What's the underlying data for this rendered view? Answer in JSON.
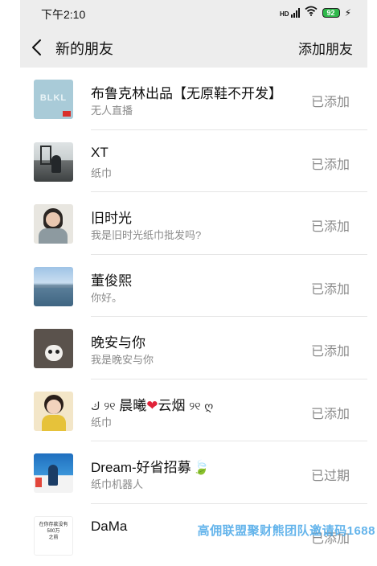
{
  "status_bar": {
    "time": "下午2:10",
    "network": "HD",
    "battery": "92"
  },
  "nav": {
    "title": "新的朋友",
    "action": "添加朋友"
  },
  "friends": [
    {
      "name": "布鲁克林出品【无原鞋不开发】",
      "note": "无人直播",
      "status": "已添加",
      "avatar_label": "BLKL"
    },
    {
      "name": "XT",
      "note": "纸巾",
      "status": "已添加"
    },
    {
      "name": "旧时光",
      "note": "我是旧时光纸巾批发吗?",
      "status": "已添加"
    },
    {
      "name": "董俊熙",
      "note": "你好。",
      "status": "已添加"
    },
    {
      "name": "晚安与你",
      "note": "我是晚安与你",
      "status": "已添加"
    },
    {
      "name_prefix": "ك",
      "name_core_1": "晨曦",
      "name_core_2": "云烟",
      "name_suffix": "ღ",
      "note": "纸巾",
      "status": "已添加"
    },
    {
      "name": "Dream-好省招募",
      "note": "纸巾机器人",
      "status": "已过期"
    },
    {
      "name": "DaMa",
      "note": "",
      "status": "已添加",
      "avatar_label": "在你存款没有\n500万\n之前"
    }
  ],
  "watermark": "高佣联盟聚财熊团队邀请码1688",
  "colors": {
    "header_bg": "#ededed",
    "secondary_text": "#8a8a8a",
    "battery": "#2fb84b",
    "watermark": "#4aa8e8"
  }
}
